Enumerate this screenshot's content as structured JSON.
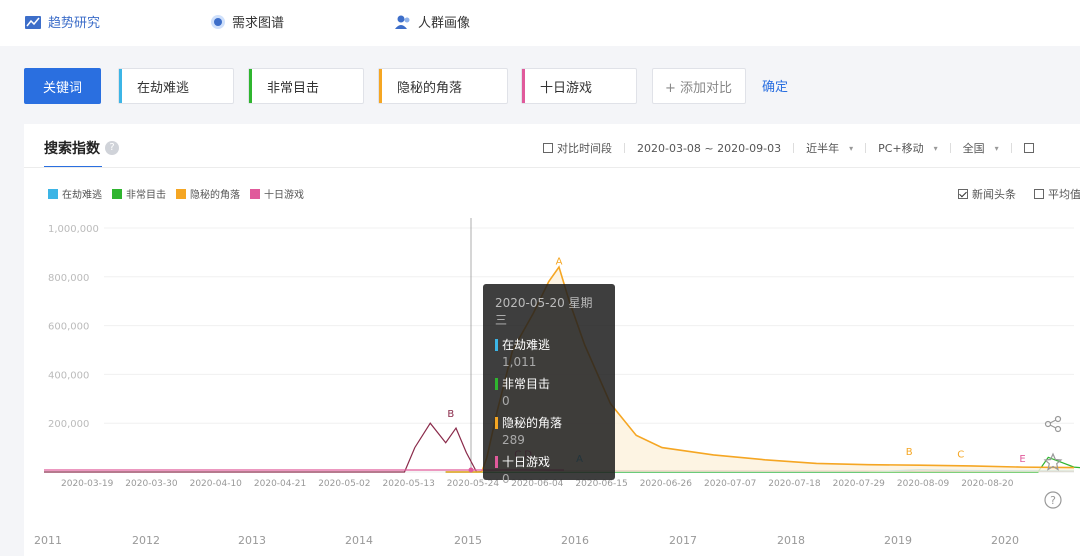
{
  "nav": {
    "items": [
      {
        "label": "趋势研究",
        "icon": "trend-icon"
      },
      {
        "label": "需求图谱",
        "icon": "radar-icon"
      },
      {
        "label": "人群画像",
        "icon": "users-icon"
      }
    ]
  },
  "keywords": {
    "label": "关键词",
    "items": [
      "在劫难逃",
      "非常目击",
      "隐秘的角落",
      "十日游戏"
    ],
    "add_label": "+ 添加对比",
    "confirm_label": "确定"
  },
  "panel": {
    "title": "搜索指数",
    "help": "?",
    "compare_label": "对比时间段",
    "date_range": "2020-03-08 ~ 2020-09-03",
    "period": "近半年",
    "device": "PC+移动",
    "region": "全国",
    "news_label": "新闻头条",
    "avg_label": "平均值"
  },
  "colors": {
    "s1": "#3cb5e6",
    "s2": "#2fb52f",
    "s3": "#f5a623",
    "s4": "#e05a9b",
    "accent": "#2a6fe0"
  },
  "chart_data": {
    "type": "line",
    "ylim": [
      0,
      1000000
    ],
    "yticks": [
      "1,000,000",
      "800,000",
      "600,000",
      "400,000",
      "200,000"
    ],
    "ytick_values": [
      1000000,
      800000,
      600000,
      400000,
      200000
    ],
    "xtick_labels": [
      "2020-03-19",
      "2020-03-30",
      "2020-04-10",
      "2020-04-21",
      "2020-05-02",
      "2020-05-13",
      "2020-05-24",
      "2020-06-04",
      "2020-06-15",
      "2020-06-26",
      "2020-07-07",
      "2020-07-18",
      "2020-07-29",
      "2020-08-09",
      "2020-08-20"
    ],
    "annotations": [
      "A",
      "B",
      "C",
      "D",
      "A",
      "B",
      "C",
      "E"
    ],
    "series": [
      {
        "name": "在劫难逃",
        "values": [
          [
            78,
            0
          ],
          [
            160,
            0
          ],
          [
            170,
            10000
          ],
          [
            180,
            6000
          ],
          [
            200,
            4000
          ]
        ]
      },
      {
        "name": "非常目击",
        "values": [
          [
            78,
            0
          ],
          [
            193,
            0
          ],
          [
            195,
            60000
          ],
          [
            200,
            20000
          ],
          [
            210,
            2000
          ]
        ]
      },
      {
        "name": "隐秘的角落",
        "values": [
          [
            78,
            0
          ],
          [
            85,
            0
          ],
          [
            86,
            60000
          ],
          [
            88,
            250000
          ],
          [
            91,
            500000
          ],
          [
            95,
            650000
          ],
          [
            98,
            780000
          ],
          [
            100,
            840000
          ],
          [
            102,
            700000
          ],
          [
            105,
            520000
          ],
          [
            110,
            280000
          ],
          [
            115,
            150000
          ],
          [
            120,
            100000
          ],
          [
            130,
            70000
          ],
          [
            140,
            50000
          ],
          [
            150,
            35000
          ],
          [
            160,
            30000
          ],
          [
            170,
            28000
          ],
          [
            180,
            25000
          ],
          [
            190,
            20000
          ],
          [
            200,
            18000
          ]
        ]
      },
      {
        "name": "十日游戏",
        "values": [
          [
            0,
            0
          ],
          [
            70,
            0
          ],
          [
            72,
            100000
          ],
          [
            75,
            200000
          ],
          [
            78,
            120000
          ],
          [
            80,
            180000
          ],
          [
            82,
            80000
          ],
          [
            84,
            0
          ],
          [
            90,
            10000
          ],
          [
            95,
            8000
          ],
          [
            100,
            5000
          ],
          [
            110,
            4000
          ],
          [
            200,
            3000
          ]
        ]
      }
    ],
    "tooltip": {
      "date": "2020-05-20 星期三",
      "items": [
        {
          "name": "在劫难逃",
          "value": "1,011"
        },
        {
          "name": "非常目击",
          "value": "0"
        },
        {
          "name": "隐秘的角落",
          "value": "289"
        },
        {
          "name": "十日游戏",
          "value": "0"
        }
      ]
    },
    "years": [
      "2011",
      "2012",
      "2013",
      "2014",
      "2015",
      "2016",
      "2017",
      "2018",
      "2019",
      "2020"
    ]
  }
}
